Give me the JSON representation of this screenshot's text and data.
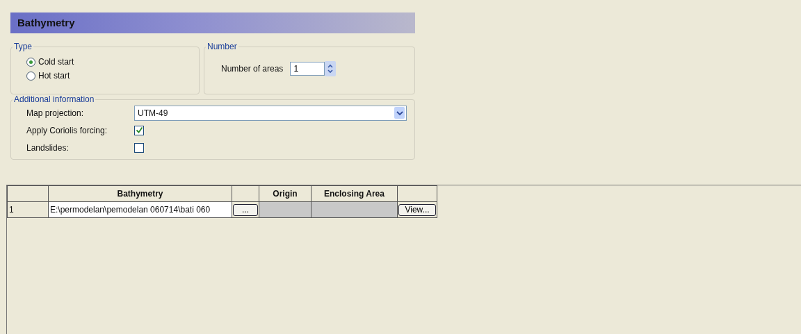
{
  "title": "Bathymetry",
  "type_group": {
    "label": "Type",
    "options": [
      {
        "label": "Cold start",
        "selected": true
      },
      {
        "label": "Hot start",
        "selected": false
      }
    ]
  },
  "number_group": {
    "label": "Number",
    "field_label": "Number of areas",
    "value": "1"
  },
  "additional": {
    "label": "Additional information",
    "map_projection": {
      "label": "Map projection:",
      "value": "UTM-49"
    },
    "checks": [
      {
        "label": "Apply Coriolis forcing:",
        "checked": true
      },
      {
        "label": "Landslides:",
        "checked": false
      }
    ]
  },
  "table": {
    "columns": [
      "Bathymetry",
      "Origin",
      "Enclosing Area"
    ],
    "rows": [
      {
        "index": "1",
        "bathymetry": "E:\\permodelan\\pemodelan 060714\\bati 060",
        "browse": "...",
        "view": "View..."
      }
    ]
  }
}
